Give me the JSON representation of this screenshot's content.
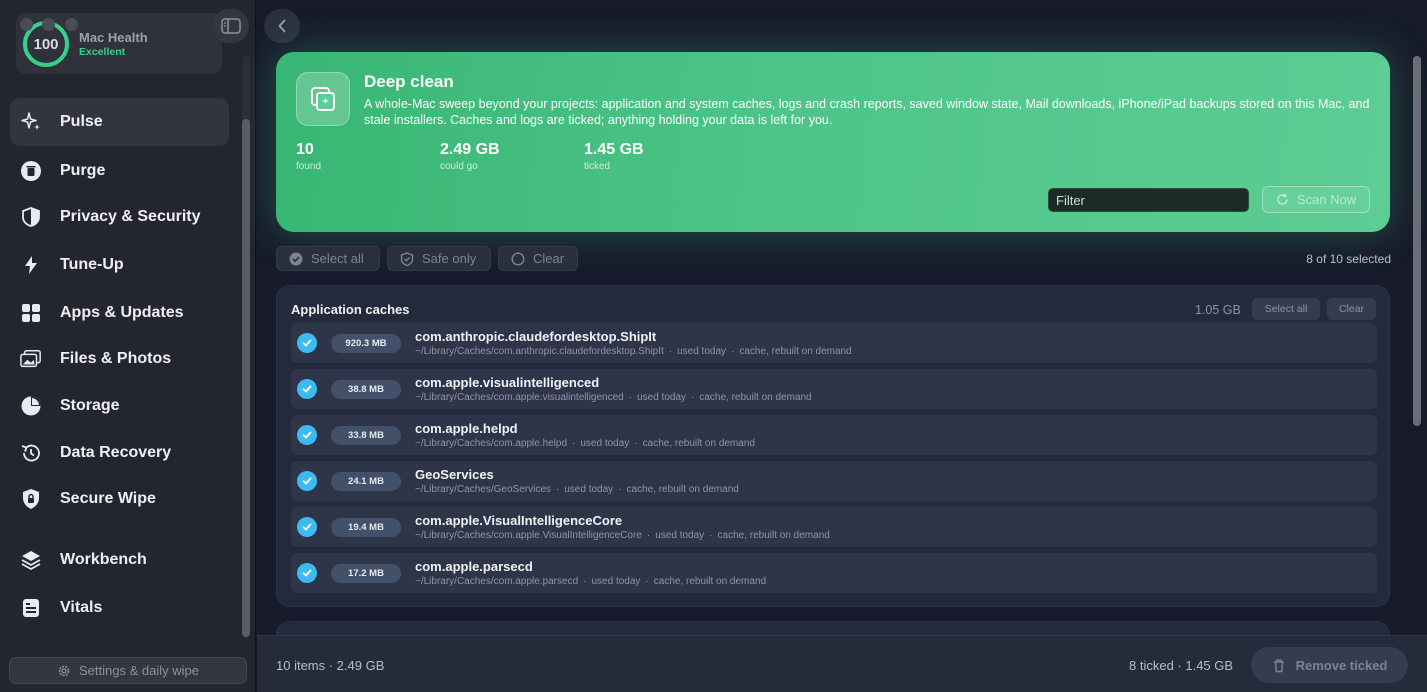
{
  "sidebar": {
    "health": {
      "score": "100",
      "title": "Mac Health",
      "status": "Excellent"
    },
    "items": [
      {
        "label": "Pulse",
        "icon": "sparkle-icon",
        "active": true
      },
      {
        "label": "Purge",
        "icon": "trash-icon"
      },
      {
        "label": "Privacy & Security",
        "icon": "shield-icon"
      },
      {
        "label": "Tune-Up",
        "icon": "bolt-icon"
      },
      {
        "label": "Apps & Updates",
        "icon": "grid-icon"
      },
      {
        "label": "Files & Photos",
        "icon": "photos-icon"
      },
      {
        "label": "Storage",
        "icon": "pie-chart-icon"
      },
      {
        "label": "Data Recovery",
        "icon": "history-icon"
      },
      {
        "label": "Secure Wipe",
        "icon": "lock-shield-icon"
      },
      {
        "label": "Workbench",
        "icon": "layers-icon"
      },
      {
        "label": "Vitals",
        "icon": "vitals-icon"
      }
    ],
    "settings_label": "Settings & daily wipe"
  },
  "hero": {
    "title": "Deep clean",
    "description": "A whole-Mac sweep beyond your projects: application and system caches, logs and crash reports, saved window state, Mail downloads, iPhone/iPad backups stored on this Mac, and stale installers. Caches and logs are ticked; anything holding your data is left for you.",
    "stats": [
      {
        "value": "10",
        "label": "found"
      },
      {
        "value": "2.49 GB",
        "label": "could go"
      },
      {
        "value": "1.45 GB",
        "label": "ticked"
      }
    ],
    "filter_placeholder": "Filter",
    "scan_label": "Scan Now"
  },
  "toolbar": {
    "select_all": "Select all",
    "safe_only": "Safe only",
    "clear": "Clear",
    "selected_count": "8 of 10 selected"
  },
  "group": {
    "title": "Application caches",
    "size": "1.05 GB",
    "select_all": "Select all",
    "clear": "Clear",
    "rows": [
      {
        "size": "920.3 MB",
        "name": "com.anthropic.claudefordesktop.ShipIt",
        "path": "~/Library/Caches/com.anthropic.claudefordesktop.ShipIt",
        "used": "used today",
        "note": "cache, rebuilt on demand"
      },
      {
        "size": "38.8 MB",
        "name": "com.apple.visualintelligenced",
        "path": "~/Library/Caches/com.apple.visualintelligenced",
        "used": "used today",
        "note": "cache, rebuilt on demand"
      },
      {
        "size": "33.8 MB",
        "name": "com.apple.helpd",
        "path": "~/Library/Caches/com.apple.helpd",
        "used": "used today",
        "note": "cache, rebuilt on demand"
      },
      {
        "size": "24.1 MB",
        "name": "GeoServices",
        "path": "~/Library/Caches/GeoServices",
        "used": "used today",
        "note": "cache, rebuilt on demand"
      },
      {
        "size": "19.4 MB",
        "name": "com.apple.VisualIntelligenceCore",
        "path": "~/Library/Caches/com.apple.VisualIntelligenceCore",
        "used": "used today",
        "note": "cache, rebuilt on demand"
      },
      {
        "size": "17.2 MB",
        "name": "com.apple.parsecd",
        "path": "~/Library/Caches/com.apple.parsecd",
        "used": "used today",
        "note": "cache, rebuilt on demand"
      }
    ]
  },
  "footer": {
    "summary": "10 items · 2.49 GB",
    "ticked": "8 ticked · 1.45 GB",
    "remove_label": "Remove ticked"
  },
  "colors": {
    "accent_green": "#35d08a",
    "check_blue": "#3dbbf0",
    "hero_green": "#4ec488"
  }
}
